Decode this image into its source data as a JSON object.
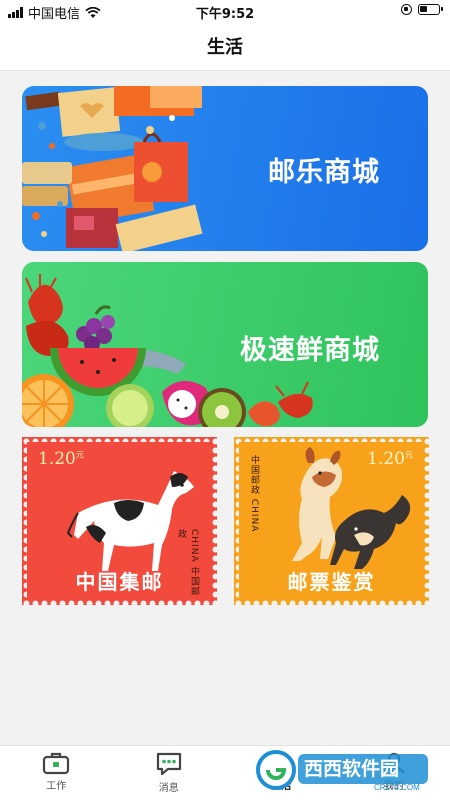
{
  "status_bar": {
    "carrier": "中国电信",
    "time": "下午9:52"
  },
  "header": {
    "title": "生活"
  },
  "banners": [
    {
      "label": "邮乐商城",
      "icon": "shopping-bags-illustration"
    },
    {
      "label": "极速鲜商城",
      "icon": "fruit-illustration"
    }
  ],
  "stamps": [
    {
      "label": "中国集邮",
      "value": "1.20",
      "value_sup": "元",
      "country": "CHINA 中国邮政",
      "color": "#f24a3c"
    },
    {
      "label": "邮票鉴赏",
      "value": "1.20",
      "value_sup": "元",
      "country": "中国邮政 CHINA",
      "color": "#f7a21a"
    }
  ],
  "tab_bar": {
    "items": [
      {
        "label": "工作",
        "icon": "briefcase-icon",
        "active": false
      },
      {
        "label": "消息",
        "icon": "chat-icon",
        "active": false
      },
      {
        "label": "生活",
        "icon": "life-icon",
        "active": true
      },
      {
        "label": "我的",
        "icon": "person-icon",
        "active": false
      }
    ]
  },
  "watermark": {
    "text": "西西软件园",
    "url": "CR173.COM"
  },
  "colors": {
    "accent_green": "#2fb35c",
    "mall_blue": "#1a6fe8",
    "fresh_green": "#2fc35c"
  }
}
